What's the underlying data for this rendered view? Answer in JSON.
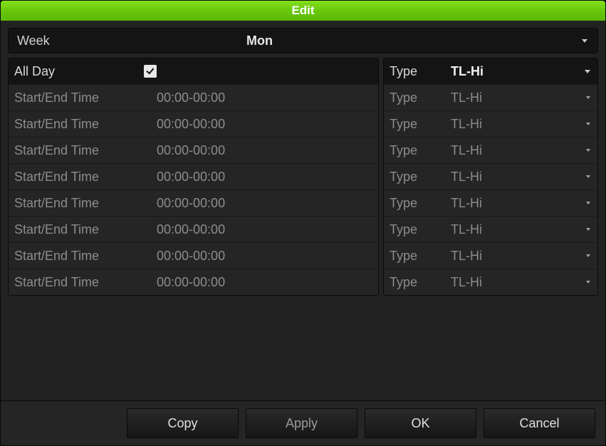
{
  "title": "Edit",
  "week": {
    "label": "Week",
    "value": "Mon"
  },
  "allday": {
    "label": "All Day",
    "checked": true
  },
  "type_label": "Type",
  "allday_type": "TL-Hi",
  "slot_label": "Start/End Time",
  "slots": [
    {
      "time": "00:00-00:00",
      "type": "TL-Hi"
    },
    {
      "time": "00:00-00:00",
      "type": "TL-Hi"
    },
    {
      "time": "00:00-00:00",
      "type": "TL-Hi"
    },
    {
      "time": "00:00-00:00",
      "type": "TL-Hi"
    },
    {
      "time": "00:00-00:00",
      "type": "TL-Hi"
    },
    {
      "time": "00:00-00:00",
      "type": "TL-Hi"
    },
    {
      "time": "00:00-00:00",
      "type": "TL-Hi"
    },
    {
      "time": "00:00-00:00",
      "type": "TL-Hi"
    }
  ],
  "buttons": {
    "copy": "Copy",
    "apply": "Apply",
    "ok": "OK",
    "cancel": "Cancel"
  }
}
